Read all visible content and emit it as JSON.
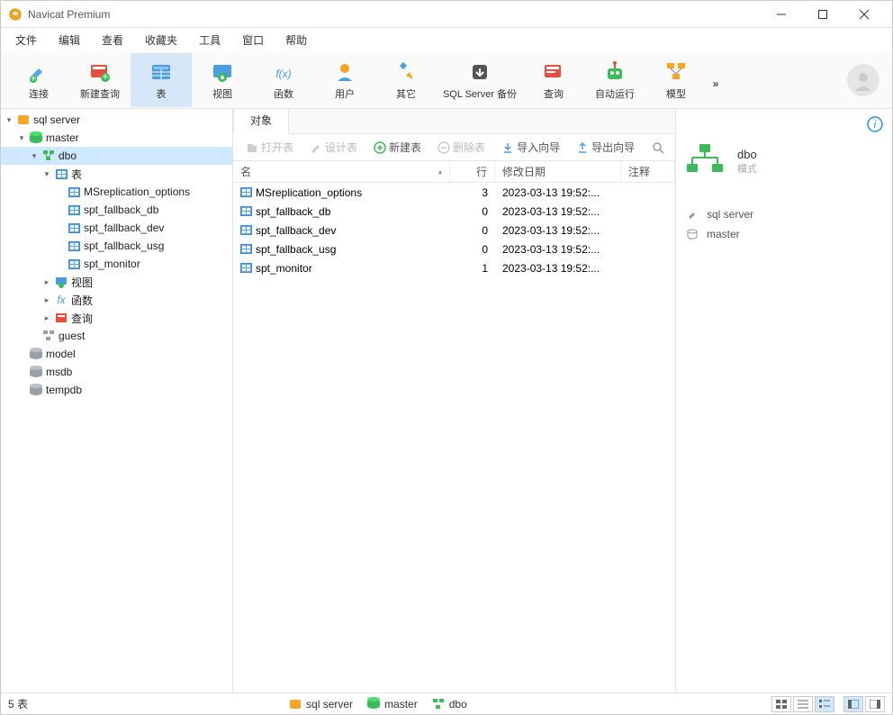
{
  "window": {
    "title": "Navicat Premium"
  },
  "menu": [
    "文件",
    "编辑",
    "查看",
    "收藏夹",
    "工具",
    "窗口",
    "帮助"
  ],
  "toolbar": [
    {
      "key": "connect",
      "label": "连接"
    },
    {
      "key": "newquery",
      "label": "新建查询"
    },
    {
      "key": "table",
      "label": "表",
      "active": true
    },
    {
      "key": "view",
      "label": "视图"
    },
    {
      "key": "function",
      "label": "函数"
    },
    {
      "key": "user",
      "label": "用户"
    },
    {
      "key": "other",
      "label": "其它"
    },
    {
      "key": "backup",
      "label": "SQL Server 备份"
    },
    {
      "key": "query",
      "label": "查询"
    },
    {
      "key": "autorun",
      "label": "自动运行"
    },
    {
      "key": "model",
      "label": "模型"
    }
  ],
  "tree": {
    "server": "sql server",
    "databases": [
      {
        "name": "master",
        "open": true,
        "schemas": [
          {
            "name": "dbo",
            "selected": true,
            "groups": [
              {
                "name": "表",
                "open": true,
                "items": [
                  "MSreplication_options",
                  "spt_fallback_db",
                  "spt_fallback_dev",
                  "spt_fallback_usg",
                  "spt_monitor"
                ]
              },
              {
                "name": "视图"
              },
              {
                "name": "函数"
              },
              {
                "name": "查询"
              }
            ]
          },
          {
            "name": "guest"
          }
        ]
      },
      {
        "name": "model"
      },
      {
        "name": "msdb"
      },
      {
        "name": "tempdb"
      }
    ]
  },
  "center": {
    "tab": "对象",
    "obj_toolbar": {
      "open": "打开表",
      "design": "设计表",
      "new": "新建表",
      "delete": "删除表",
      "import": "导入向导",
      "export": "导出向导"
    },
    "columns": {
      "name": "名",
      "rows": "行",
      "date": "修改日期",
      "note": "注释"
    },
    "rows": [
      {
        "name": "MSreplication_options",
        "rows": "3",
        "date": "2023-03-13 19:52:..."
      },
      {
        "name": "spt_fallback_db",
        "rows": "0",
        "date": "2023-03-13 19:52:..."
      },
      {
        "name": "spt_fallback_dev",
        "rows": "0",
        "date": "2023-03-13 19:52:..."
      },
      {
        "name": "spt_fallback_usg",
        "rows": "0",
        "date": "2023-03-13 19:52:..."
      },
      {
        "name": "spt_monitor",
        "rows": "1",
        "date": "2023-03-13 19:52:..."
      }
    ]
  },
  "info": {
    "name": "dbo",
    "subtitle": "模式",
    "server": "sql server",
    "db": "master"
  },
  "status": {
    "left": "5 表",
    "server": "sql server",
    "db": "master",
    "schema": "dbo"
  }
}
